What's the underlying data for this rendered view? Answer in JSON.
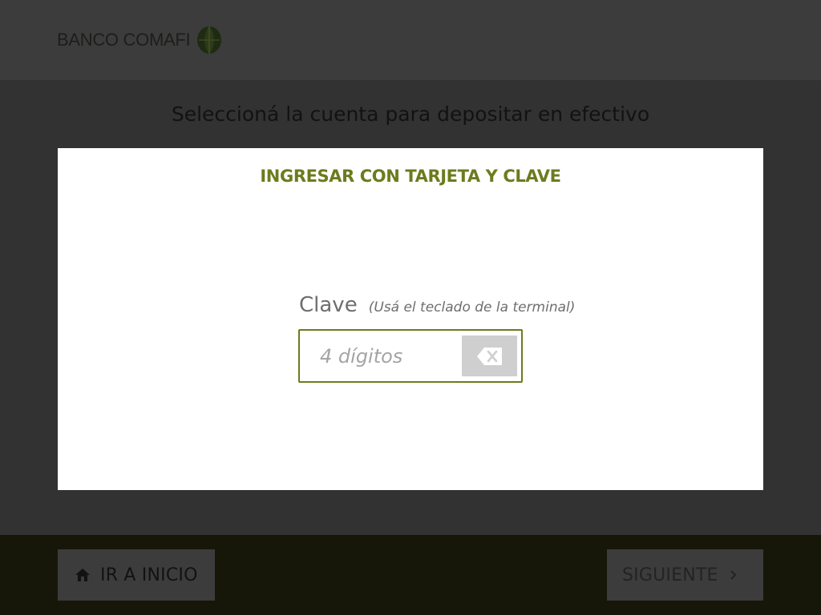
{
  "header": {
    "logo_text": "BANCO COMAFI",
    "logo_icon": "comafi-leaf-logo"
  },
  "main": {
    "title": "Seleccioná la cuenta para depositar en efectivo"
  },
  "modal": {
    "title": "INGRESAR CON TARJETA Y CLAVE",
    "pin_label": "Clave",
    "pin_hint": "(Usá el teclado de la terminal)",
    "pin_value": "",
    "pin_placeholder": "4 dígitos",
    "backspace_icon": "backspace-icon"
  },
  "footer": {
    "home_button_label": "IR A INICIO",
    "home_icon": "home-icon",
    "next_button_label": "SIGUIENTE",
    "next_icon": "chevron-right-icon"
  },
  "colors": {
    "accent": "#6b7c1c",
    "overlay_background": "#323232",
    "footer_background": "#161709",
    "modal_background": "#ffffff"
  }
}
